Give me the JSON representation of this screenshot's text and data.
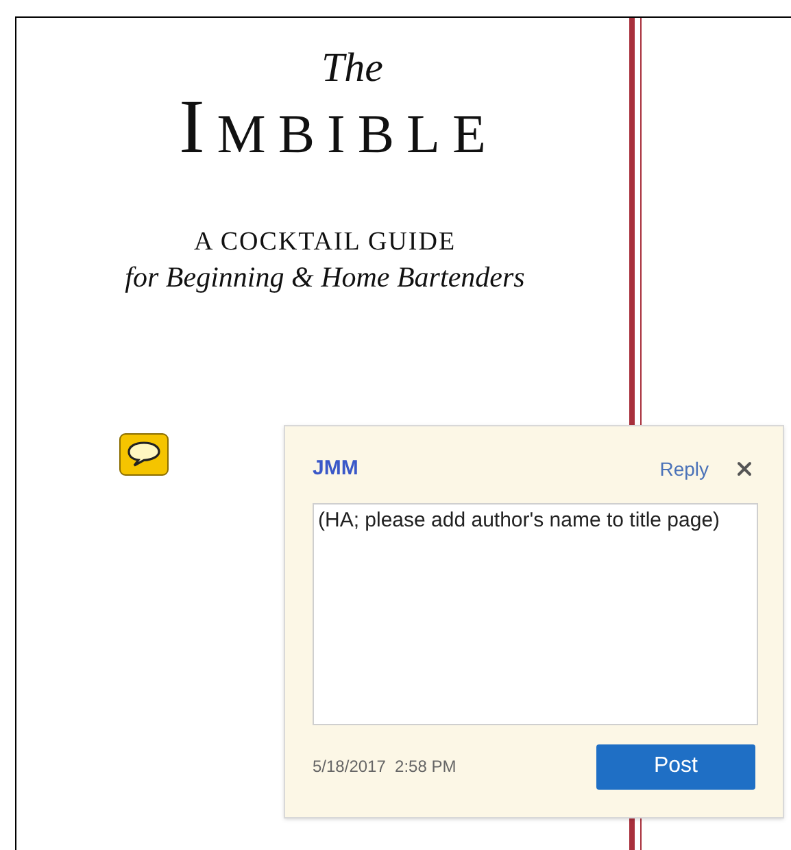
{
  "document": {
    "title_script": "The",
    "title": "IMBIBLE",
    "subtitle": "A COCKTAIL GUIDE",
    "tagline": "for Beginning & Home Bartenders"
  },
  "comment": {
    "author": "JMM",
    "reply": "Reply",
    "text": "(HA; please add author's name to title page)",
    "timestamp": "5/18/2017  2:58 PM",
    "post": "Post"
  }
}
